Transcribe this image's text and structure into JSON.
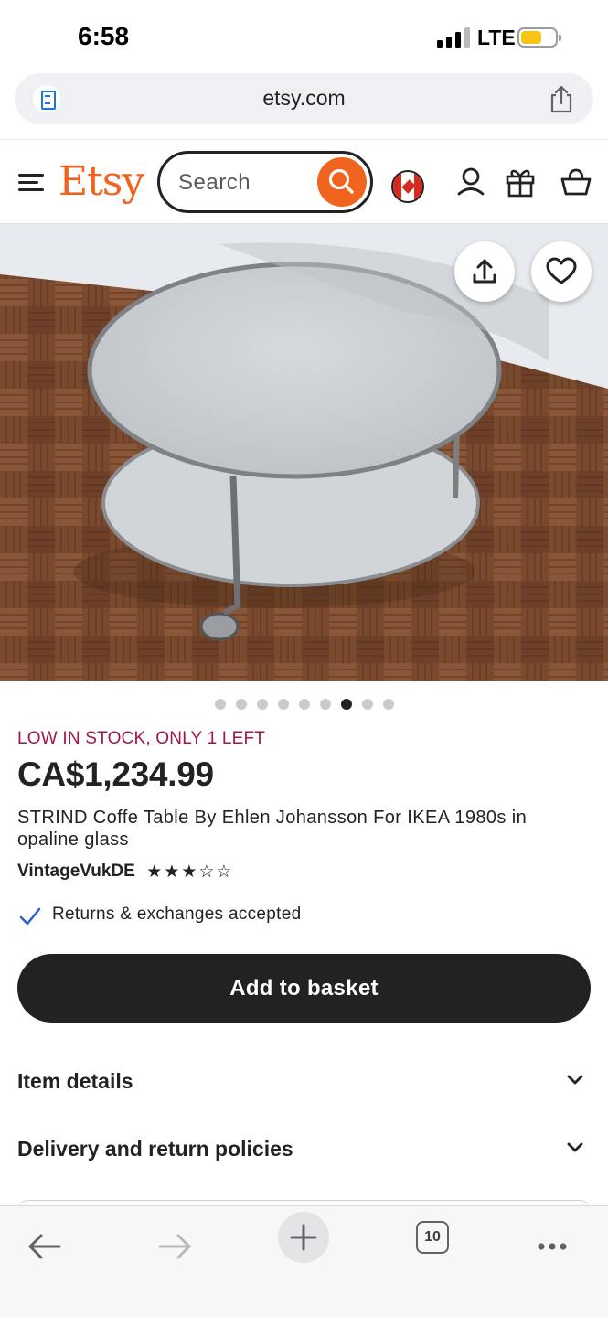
{
  "status_bar": {
    "time": "6:58",
    "network": "LTE",
    "signal_bars_active": 3,
    "signal_bars_total": 4,
    "battery_level": 0.5,
    "battery_color": "#f5c518"
  },
  "browser": {
    "url": "etsy.com",
    "reader_icon": "reader-icon",
    "share_icon": "share-icon",
    "tab_count": "10"
  },
  "header": {
    "menu_icon": "hamburger-menu-icon",
    "logo": "Etsy",
    "logo_color": "#f1641e",
    "search": {
      "placeholder": "Search",
      "button_color": "#f1641e"
    },
    "region_icon": "canada-flag-icon",
    "account_icon": "user-icon",
    "gift_icon": "gift-icon",
    "basket_icon": "basket-icon"
  },
  "gallery": {
    "share_icon": "share-icon",
    "favorite_icon": "heart-icon",
    "image_count": 9,
    "active_index": 6
  },
  "product": {
    "stock_notice": "LOW IN STOCK, ONLY 1 LEFT",
    "stock_color": "#a3144e",
    "price": "CA$1,234.99",
    "title": "STRIND Coffe Table By Ehlen Johansson For IKEA 1980s in opaline glass",
    "shop_name": "VintageVukDE",
    "rating": 3,
    "rating_max": 5,
    "rating_stars": "★★★☆☆",
    "returns": "Returns & exchanges accepted",
    "add_to_basket": "Add to basket"
  },
  "accordions": [
    {
      "label": "Item details"
    },
    {
      "label": "Delivery and return policies"
    }
  ],
  "toolbar": {
    "back_icon": "back-arrow-icon",
    "forward_icon": "forward-arrow-icon",
    "new_tab_icon": "plus-icon",
    "tabs_icon": "tabs-icon",
    "more_icon": "more-icon"
  }
}
